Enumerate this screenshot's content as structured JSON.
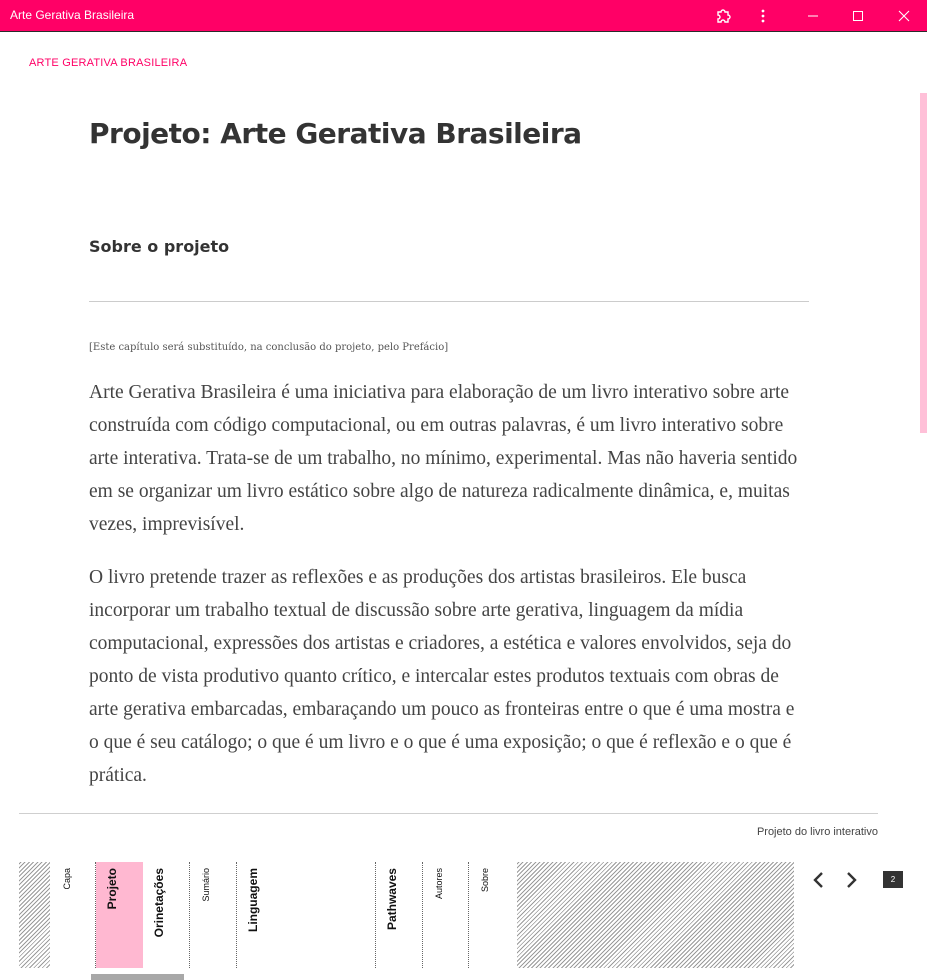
{
  "window": {
    "title": "Arte Gerativa Brasileira",
    "icons": [
      "extension-icon",
      "more-vert-icon",
      "minimize-icon",
      "maximize-icon",
      "close-icon"
    ]
  },
  "header": {
    "brand": "ARTE GERATIVA BRASILEIRA"
  },
  "main": {
    "title": "Projeto: Arte Gerativa Brasileira",
    "section_title": "Sobre o projeto",
    "note": "[Este capítulo será substituído, na conclusão do projeto, pelo Prefácio]",
    "paragraphs": [
      "Arte Gerativa Brasileira é uma iniciativa para elaboração de um livro interativo sobre arte construída com código computacional, ou em outras palavras, é um livro interativo sobre arte interativa. Trata-se de um trabalho, no mínimo, experimental. Mas não haveria sentido em se organizar um livro estático sobre algo de natureza radicalmente dinâmica, e, muitas vezes, imprevisível.",
      "O livro pretende trazer as reflexões e as produções dos artistas brasileiros. Ele busca incorporar um trabalho textual de discussão sobre arte gerativa, linguagem da mídia computacional, expressões dos artistas e criadores, a estética e valores envolvidos, seja do ponto de vista produtivo quanto crítico, e intercalar estes produtos textuais com obras de arte gerativa embarcadas, embaraçando um pouco as fronteiras entre o que é uma mostra e o que é seu catálogo; o que é um livro e o que é uma exposição; o que é reflexão e o que é prática."
    ]
  },
  "footer": {
    "label": "Projeto do livro interativo",
    "nav_items": [
      {
        "label": "Capa",
        "active": false
      },
      {
        "label": "Projeto",
        "active": true
      },
      {
        "label": "Orinetações",
        "active": false
      },
      {
        "label": "Sumário",
        "active": false
      },
      {
        "label": "Linguagem",
        "active": false
      },
      {
        "label": "Pathwaves",
        "active": false
      },
      {
        "label": "Autores",
        "active": false
      },
      {
        "label": "Sobre",
        "active": false
      }
    ],
    "page_number": "2",
    "accent_color": "#ff0066",
    "active_color": "#ffb8d1"
  }
}
